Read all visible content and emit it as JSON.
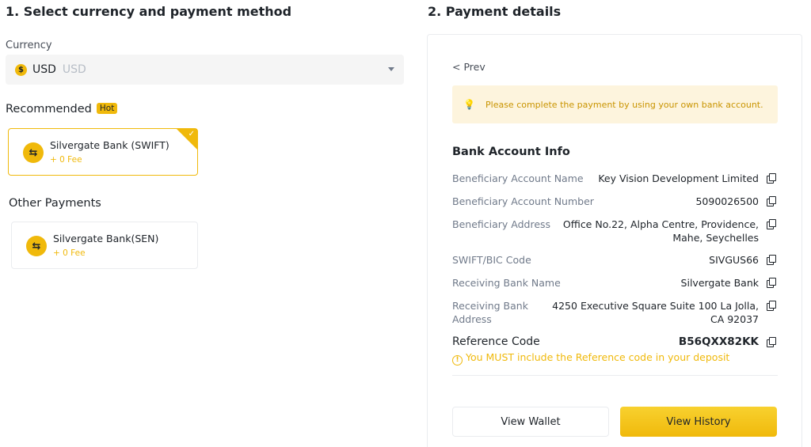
{
  "left": {
    "title": "1. Select currency and payment method",
    "currency_label": "Currency",
    "currency": {
      "icon": "dollar-coin-icon",
      "glyph": "$",
      "code": "USD",
      "sub": "USD"
    },
    "recommended_label": "Recommended",
    "hot_badge": "Hot",
    "recommended": [
      {
        "name": "Silvergate Bank (SWIFT)",
        "fee": "+ 0 Fee",
        "icon": "transfer-icon"
      }
    ],
    "other_label": "Other Payments",
    "other": [
      {
        "name": "Silvergate Bank(SEN)",
        "fee": "+ 0 Fee",
        "icon": "transfer-icon"
      }
    ]
  },
  "right": {
    "title": "2. Payment details",
    "prev": "< Prev",
    "notice": "Please complete the payment by using your own bank account.",
    "bank_title": "Bank Account Info",
    "rows": [
      {
        "label": "Beneficiary Account Name",
        "value": "Key Vision Development Limited"
      },
      {
        "label": "Beneficiary Account Number",
        "value": "5090026500"
      },
      {
        "label": "Beneficiary Address",
        "value_lines": [
          "Office No.22, Alpha Centre, Providence,",
          "Mahe, Seychelles"
        ]
      },
      {
        "label": "SWIFT/BIC Code",
        "value": "SIVGUS66"
      },
      {
        "label": "Receiving Bank Name",
        "value": "Silvergate Bank"
      },
      {
        "label_lines": [
          "Receiving Bank",
          "Address"
        ],
        "value_lines": [
          "4250 Executive Square Suite 100 La Jolla,",
          "CA 92037"
        ]
      }
    ],
    "reference_label": "Reference Code",
    "reference_value": "B56QXX82KK",
    "warning": "You MUST include the Reference code in your deposit",
    "buttons": {
      "view_wallet": "View Wallet",
      "view_history": "View History"
    }
  },
  "colors": {
    "accent": "#f0b90b",
    "notice_bg": "#fdf4dd",
    "text": "#1e2329",
    "muted": "#707a8a"
  }
}
